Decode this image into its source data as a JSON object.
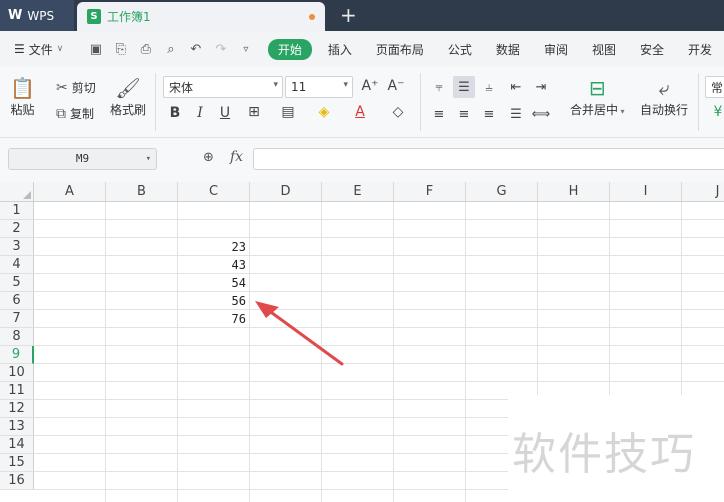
{
  "titlebar": {
    "app_label": "WPS",
    "doc_title": "工作簿1"
  },
  "menubar": {
    "file_label": "文件",
    "tabs": [
      "开始",
      "插入",
      "页面布局",
      "公式",
      "数据",
      "审阅",
      "视图",
      "安全",
      "开发"
    ]
  },
  "ribbon": {
    "paste": "粘贴",
    "cut": "剪切",
    "copy": "复制",
    "format_painter": "格式刷",
    "font_name": "宋体",
    "font_size": "11",
    "merge_center": "合并居中",
    "wrap_text": "自动换行",
    "number_format": "常"
  },
  "formulabar": {
    "name_box": "M9",
    "fx": "fx"
  },
  "grid": {
    "columns": [
      "A",
      "B",
      "C",
      "D",
      "E",
      "F",
      "G",
      "H",
      "I",
      "J"
    ],
    "rows": [
      "1",
      "2",
      "3",
      "4",
      "5",
      "6",
      "7",
      "8",
      "9",
      "10",
      "11",
      "12",
      "13",
      "14",
      "15",
      "16"
    ],
    "active_row": "9",
    "values": {
      "C3": "23",
      "C4": "43",
      "C5": "54",
      "C6": "56",
      "C7": "76"
    }
  },
  "watermark": "软件技巧",
  "colors": {
    "accent": "#2aa463",
    "titlebar": "#2f3a4b",
    "annotation_arrow": "#e04a4a"
  }
}
